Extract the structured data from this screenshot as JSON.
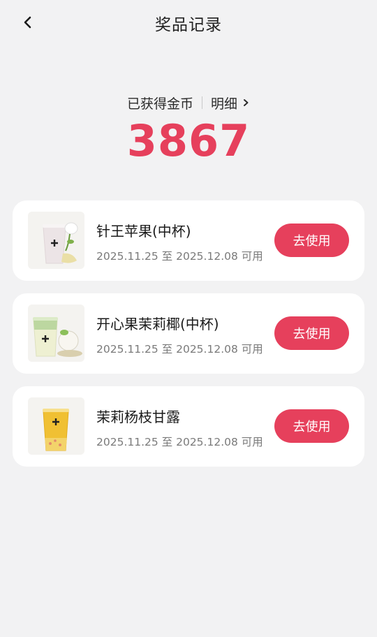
{
  "header": {
    "title": "奖品记录",
    "back_icon": "chevron-left-icon"
  },
  "summary": {
    "label": "已获得金币",
    "detail_label": "明细",
    "coin_count": "3867",
    "accent_color": "#e6405c"
  },
  "prizes": [
    {
      "name": "针王苹果(中杯)",
      "date": "2025.11.25 至 2025.12.08 可用",
      "button": "去使用",
      "image_icon": "apple-milk-tea-cup-image"
    },
    {
      "name": "开心果茉莉椰(中杯)",
      "date": "2025.11.25 至 2025.12.08 可用",
      "button": "去使用",
      "image_icon": "pistachio-coconut-tea-cup-image"
    },
    {
      "name": "茉莉杨枝甘露",
      "date": "2025.11.25 至 2025.12.08 可用",
      "button": "去使用",
      "image_icon": "mango-pomelo-tea-cup-image"
    }
  ]
}
